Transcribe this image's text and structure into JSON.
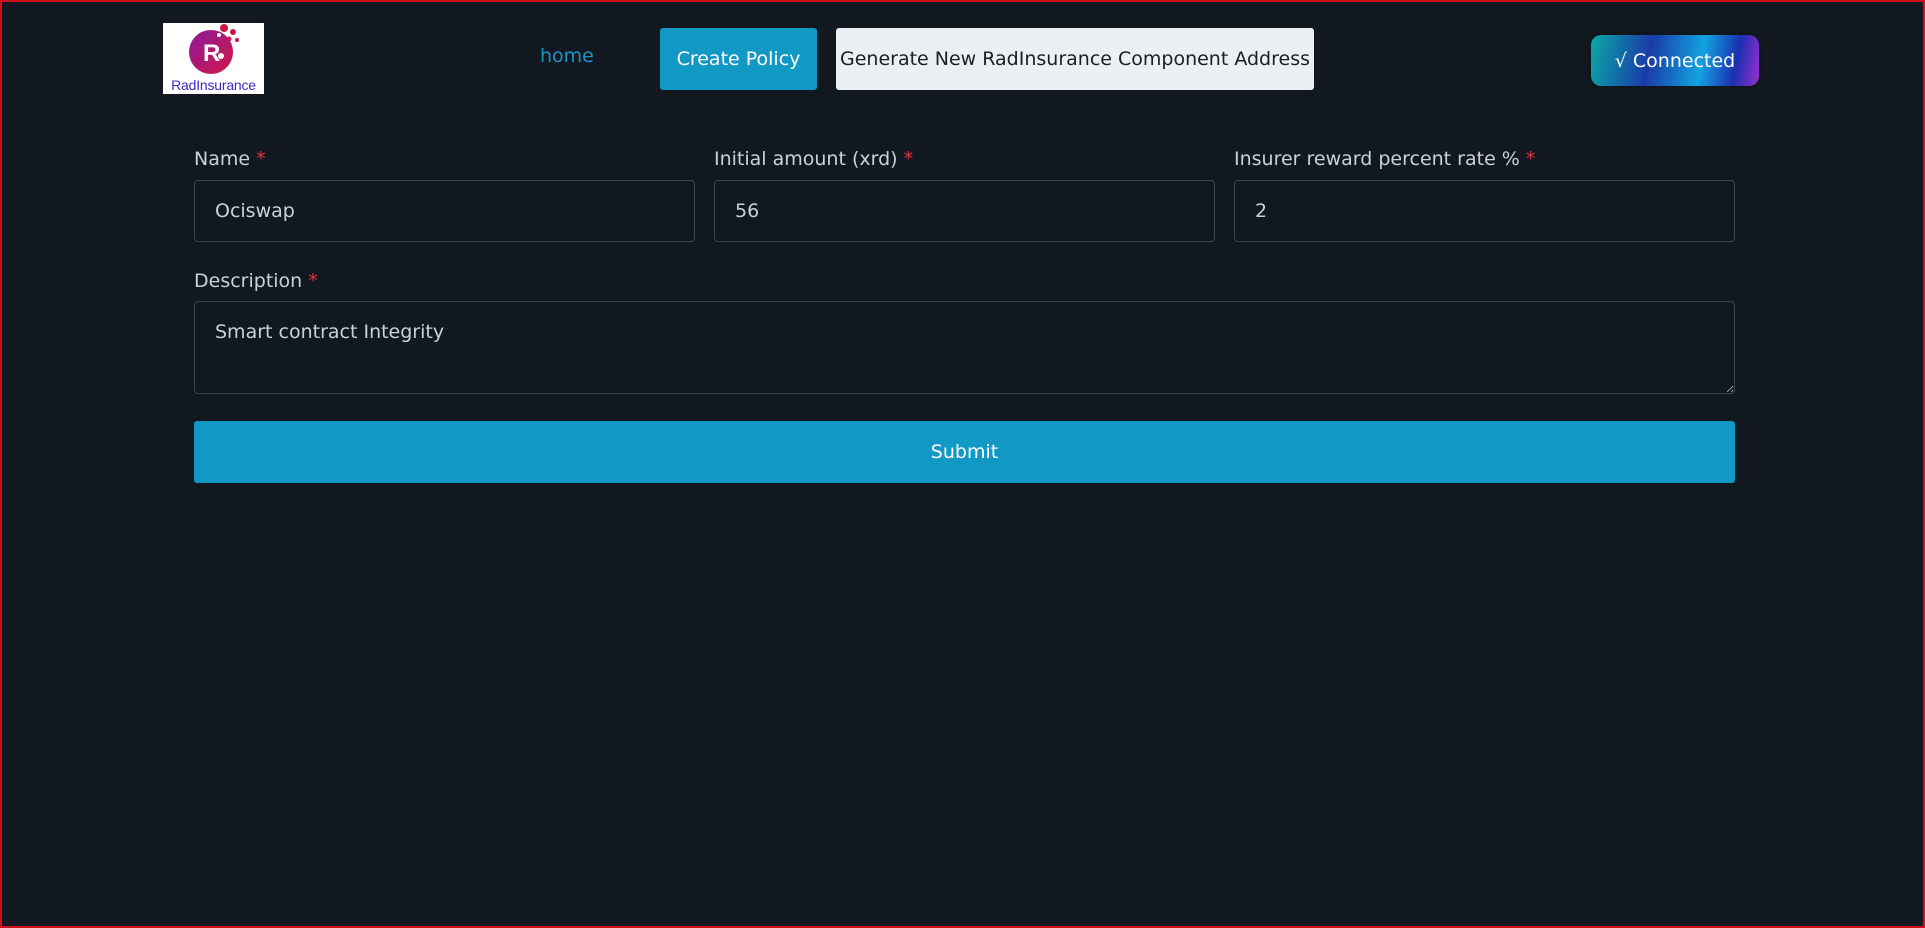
{
  "brand": {
    "logo_text": "RadInsurance",
    "logo_colors": {
      "circle_start": "#8b1a9a",
      "circle_end": "#d01848",
      "text": "#3d2bc7"
    }
  },
  "nav": {
    "home_label": "home",
    "create_policy_label": "Create Policy",
    "generate_label": "Generate New RadInsurance Component Address",
    "connected_label": "√ Connected"
  },
  "form": {
    "name": {
      "label": "Name",
      "required_mark": "*",
      "value": "Ociswap"
    },
    "initial_amount": {
      "label": "Initial amount (xrd)",
      "required_mark": "*",
      "value": "56"
    },
    "reward_rate": {
      "label": "Insurer reward percent rate %",
      "required_mark": "*",
      "value": "2"
    },
    "description": {
      "label": "Description",
      "required_mark": "*",
      "value": "Smart contract Integrity"
    },
    "submit_label": "Submit"
  },
  "colors": {
    "background": "#111820",
    "accent": "#1198c4",
    "required": "#e5343b",
    "frame": "#d10f1a"
  }
}
